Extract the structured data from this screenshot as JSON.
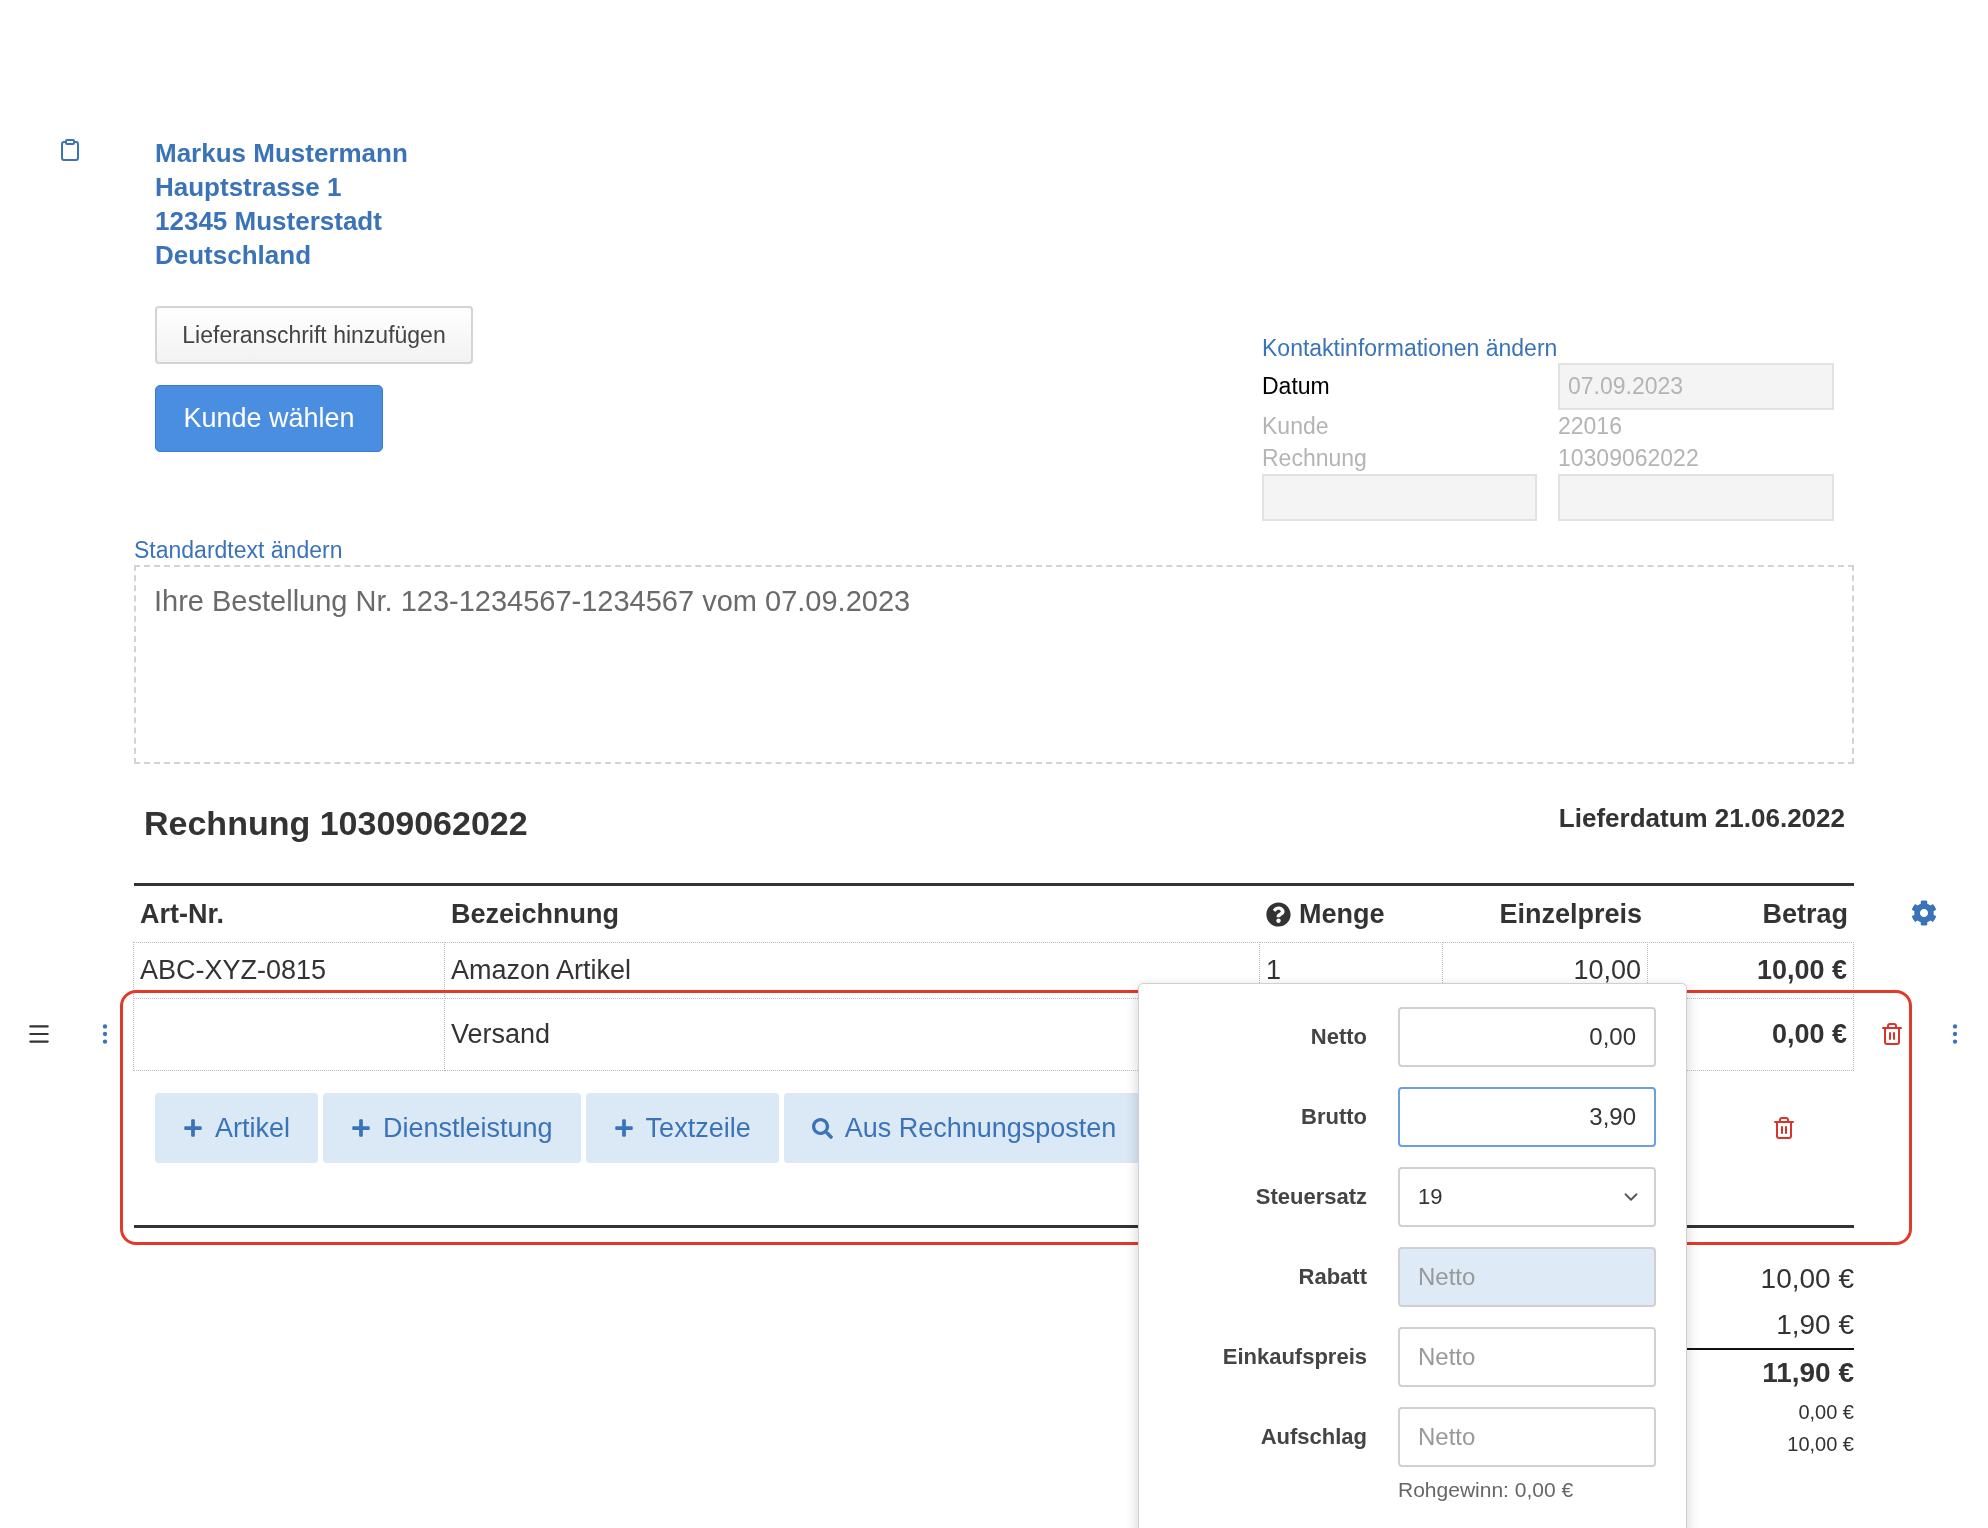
{
  "customer": {
    "address_lines": [
      "Markus Mustermann",
      "Hauptstrasse 1",
      "12345 Musterstadt",
      "Deutschland"
    ]
  },
  "customer_buttons": {
    "delivery_address": "Lieferanschrift hinzufügen",
    "choose_customer": "Kunde wählen"
  },
  "contact": {
    "link": "Kontaktinformationen ändern",
    "rows": [
      {
        "kind": "field",
        "label": "Datum",
        "value": "07.09.2023"
      },
      {
        "kind": "text",
        "label": "Kunde",
        "value": "22016"
      },
      {
        "kind": "text",
        "label": "Rechnung",
        "value": "10309062022"
      },
      {
        "kind": "blank"
      }
    ]
  },
  "intro": {
    "link": "Standardtext ändern",
    "text": "Ihre Bestellung Nr. 123-1234567-1234567 vom 07.09.2023"
  },
  "invoice": {
    "title": "Rechnung 10309062022",
    "delivery_date": "Lieferdatum 21.06.2022"
  },
  "table": {
    "columns": [
      {
        "label": "Art-Nr.",
        "help": false
      },
      {
        "label": "Bezeichnung",
        "help": false
      },
      {
        "label": "Menge",
        "help": true
      },
      {
        "label": "Einzelpreis",
        "help": false
      },
      {
        "label": "Betrag",
        "help": false
      }
    ],
    "rows": [
      {
        "article_no": "ABC-XYZ-0815",
        "name": "Amazon Artikel",
        "quantity": "1",
        "unit_price": "10,00",
        "amount": "10,00 €",
        "controls": false
      },
      {
        "name": "Versand",
        "amount": "0,00 €",
        "controls": true
      }
    ]
  },
  "add_buttons": [
    {
      "kind": "plus",
      "label": "Artikel"
    },
    {
      "kind": "plus",
      "label": "Dienstleistung"
    },
    {
      "kind": "plus",
      "label": "Textzeile"
    },
    {
      "kind": "search",
      "label": "Aus Rechnungsposten"
    }
  ],
  "popup": {
    "fields": [
      {
        "kind": "input",
        "label": "Netto",
        "value": "0,00",
        "focused": false,
        "highlighted": false
      },
      {
        "kind": "input",
        "label": "Brutto",
        "value": "3,90",
        "focused": true,
        "highlighted": false
      },
      {
        "kind": "select",
        "label": "Steuersatz",
        "value": "19",
        "focused": false,
        "highlighted": false
      },
      {
        "kind": "input",
        "label": "Rabatt",
        "placeholder": "Netto",
        "focused": false,
        "highlighted": true
      },
      {
        "kind": "input",
        "label": "Einkaufspreis",
        "placeholder": "Netto",
        "focused": false,
        "highlighted": false
      },
      {
        "kind": "input",
        "label": "Aufschlag",
        "placeholder": "Netto",
        "focused": false,
        "highlighted": false
      }
    ],
    "note": "Rohgewinn: 0,00 €"
  },
  "totals": [
    {
      "kind": "normal",
      "value": "10,00 €"
    },
    {
      "kind": "normal",
      "value": "1,90 €"
    },
    {
      "kind": "total",
      "value": "11,90 €"
    },
    {
      "kind": "small",
      "value": "0,00 €"
    },
    {
      "kind": "small",
      "value": "10,00 €"
    }
  ],
  "annotation": {
    "kind": "frame"
  }
}
